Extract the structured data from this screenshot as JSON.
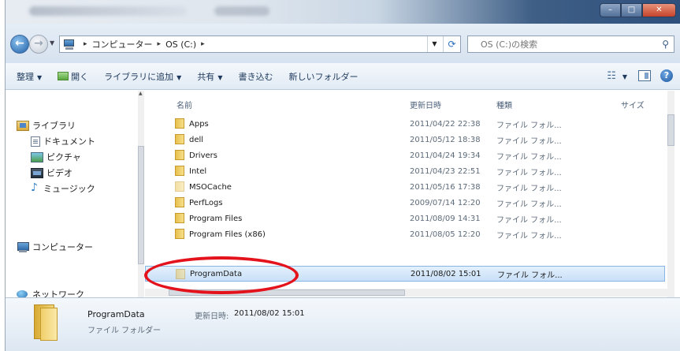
{
  "address": {
    "crumbs": [
      "コンピューター",
      "OS (C:)"
    ],
    "search_placeholder": "OS (C:)の検索"
  },
  "toolbar": {
    "organize": "整理",
    "open": "開く",
    "add_to_library": "ライブラリに追加",
    "share": "共有",
    "burn": "書き込む",
    "new_folder": "新しいフォルダー"
  },
  "nav": {
    "libraries": "ライブラリ",
    "documents": "ドキュメント",
    "pictures": "ピクチャ",
    "videos": "ビデオ",
    "music": "ミュージック",
    "computer": "コンピューター",
    "network": "ネットワーク"
  },
  "columns": {
    "name": "名前",
    "date": "更新日時",
    "type": "種類",
    "size": "サイズ"
  },
  "files": [
    {
      "name": "Apps",
      "date": "2011/04/22 22:38",
      "type": "ファイル フォル..."
    },
    {
      "name": "dell",
      "date": "2011/05/12 18:38",
      "type": "ファイル フォル..."
    },
    {
      "name": "Drivers",
      "date": "2011/04/24 19:34",
      "type": "ファイル フォル..."
    },
    {
      "name": "Intel",
      "date": "2011/04/23 22:51",
      "type": "ファイル フォル..."
    },
    {
      "name": "MSOCache",
      "date": "2011/05/16 17:38",
      "type": "ファイル フォル..."
    },
    {
      "name": "PerfLogs",
      "date": "2009/07/14 12:20",
      "type": "ファイル フォル..."
    },
    {
      "name": "Program Files",
      "date": "2011/08/09 14:31",
      "type": "ファイル フォル..."
    },
    {
      "name": "Program Files (x86)",
      "date": "2011/08/05 12:20",
      "type": "ファイル フォル..."
    },
    {
      "name": "ProgramData",
      "date": "2011/08/02 15:01",
      "type": "ファイル フォル..."
    }
  ],
  "details": {
    "name": "ProgramData",
    "date_label": "更新日時:",
    "date": "2011/08/02 15:01",
    "type": "ファイル フォルダー"
  },
  "colors": {
    "annotation": "#e3121b",
    "selection": "#c9e0f8"
  }
}
